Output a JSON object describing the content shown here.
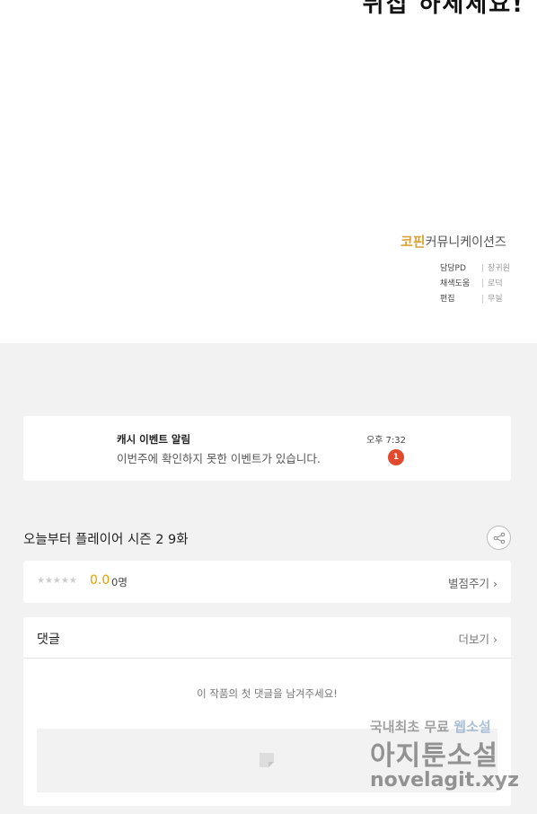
{
  "comic": {
    "cut_text": "뒤집 하세세요!",
    "credits": {
      "brand_main": "코핀",
      "brand_sub": "커뮤니케이션즈",
      "rows": [
        {
          "role": "담당PD",
          "name": "장귀원"
        },
        {
          "role": "채색도움",
          "name": "로덕"
        },
        {
          "role": "편집",
          "name": "무늴"
        }
      ]
    }
  },
  "notice": {
    "title": "캐시 이벤트 알림",
    "body": "이번주에 확인하지 못한 이벤트가 있습니다.",
    "time": "오후 7:32",
    "badge": "1"
  },
  "episode": {
    "title": "오늘부터 플레이어 시즌 2 9화",
    "share_icon": "share-icon"
  },
  "rating": {
    "stars": "★★★★★",
    "star_value": 0,
    "score": "0.0",
    "voters": "0명",
    "rate_label": "별점주기 ›"
  },
  "comments": {
    "header": "댓글",
    "more_label": "더보기 ›",
    "empty_text": "이 작품의 첫 댓글을 남겨주세요!"
  },
  "watermark": {
    "line1_a": "국내최초 무료",
    "line1_b": "웹소설",
    "line2": "아지툰소설",
    "line3": "novelagit.xyz"
  },
  "colors": {
    "accent": "#e0a000",
    "badge": "#e24a2e",
    "brand": "#d9a33a"
  }
}
